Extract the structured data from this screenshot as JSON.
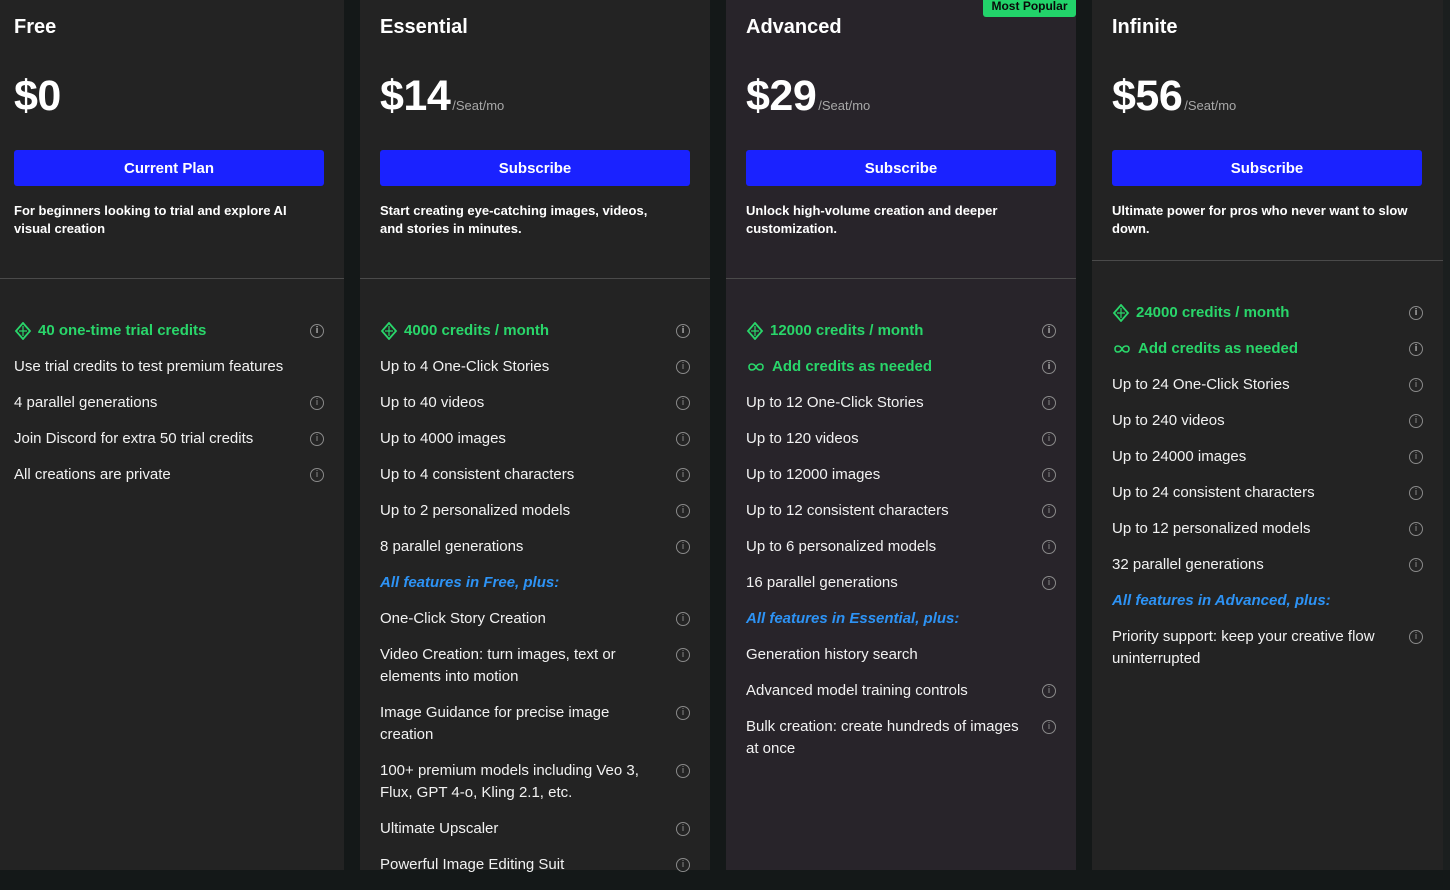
{
  "badge": {
    "most_popular": "Most Popular"
  },
  "plans": [
    {
      "name": "Free",
      "price": "$0",
      "per": "",
      "button": "Current Plan",
      "description": "For beginners looking to trial and explore AI visual creation",
      "credits": "40 one-time trial credits",
      "features": [
        {
          "label": "Use trial credits to test premium features",
          "info": false
        },
        {
          "label": "4 parallel generations",
          "info": true
        },
        {
          "label": "Join Discord for extra 50 trial credits",
          "info": true
        },
        {
          "label": "All creations are private",
          "info": true
        }
      ]
    },
    {
      "name": "Essential",
      "price": "$14",
      "per": "/Seat/mo",
      "button": "Subscribe",
      "description": "Start creating eye-catching images, videos, and stories in minutes.",
      "credits": "4000 credits / month",
      "features": [
        {
          "label": "Up to 4 One-Click Stories",
          "info": true
        },
        {
          "label": "Up to 40 videos",
          "info": true
        },
        {
          "label": "Up to 4000 images",
          "info": true
        },
        {
          "label": "Up to 4 consistent characters",
          "info": true
        },
        {
          "label": "Up to 2 personalized models",
          "info": true
        },
        {
          "label": "8 parallel generations",
          "info": true
        }
      ],
      "section": "All features in Free, plus:",
      "extras": [
        {
          "label": "One-Click Story Creation",
          "info": true
        },
        {
          "label": "Video Creation: turn images, text or elements into motion",
          "info": true
        },
        {
          "label": "Image Guidance for precise image creation",
          "info": true
        },
        {
          "label": "100+ premium models including Veo 3, Flux, GPT 4-o, Kling 2.1, etc.",
          "info": true
        },
        {
          "label": "Ultimate Upscaler",
          "info": true
        },
        {
          "label": "Powerful Image Editing Suit",
          "info": true
        }
      ]
    },
    {
      "name": "Advanced",
      "price": "$29",
      "per": "/Seat/mo",
      "button": "Subscribe",
      "description": "Unlock high-volume creation and deeper customization.",
      "credits": "12000 credits / month",
      "add_credits": "Add credits as needed",
      "features": [
        {
          "label": "Up to 12 One-Click Stories",
          "info": true
        },
        {
          "label": "Up to 120 videos",
          "info": true
        },
        {
          "label": "Up to 12000 images",
          "info": true
        },
        {
          "label": "Up to 12 consistent characters",
          "info": true
        },
        {
          "label": "Up to 6 personalized models",
          "info": true
        },
        {
          "label": "16 parallel generations",
          "info": true
        }
      ],
      "section": "All features in Essential, plus:",
      "extras": [
        {
          "label": "Generation history search",
          "info": false
        },
        {
          "label": "Advanced model training controls",
          "info": true
        },
        {
          "label": "Bulk creation: create hundreds of images at once",
          "info": true
        }
      ]
    },
    {
      "name": "Infinite",
      "price": "$56",
      "per": "/Seat/mo",
      "button": "Subscribe",
      "description": "Ultimate power for pros who never want to slow down.",
      "credits": "24000 credits / month",
      "add_credits": "Add credits as needed",
      "features": [
        {
          "label": "Up to 24 One-Click Stories",
          "info": true
        },
        {
          "label": "Up to 240 videos",
          "info": true
        },
        {
          "label": "Up to 24000 images",
          "info": true
        },
        {
          "label": "Up to 24 consistent characters",
          "info": true
        },
        {
          "label": "Up to 12 personalized models",
          "info": true
        },
        {
          "label": "32 parallel generations",
          "info": true
        }
      ],
      "section": "All features in Advanced, plus:",
      "extras": [
        {
          "label": "Priority support: keep your creative flow uninterrupted",
          "info": true
        }
      ]
    }
  ],
  "colors": {
    "accent_button": "#1a22ff",
    "credits_green": "#29d66a",
    "section_blue": "#2d93f5",
    "badge_green": "#22d36a"
  },
  "icons": {
    "credits": "diamond-gem-icon",
    "add_credits": "infinity-icon",
    "info": "info-circle-icon"
  }
}
